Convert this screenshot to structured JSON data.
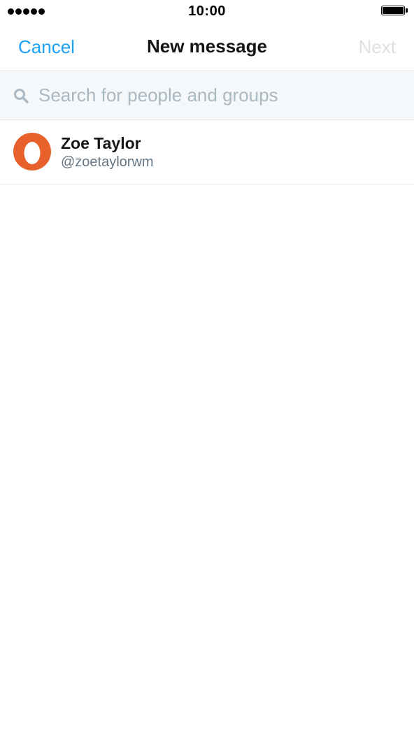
{
  "status_bar": {
    "time": "10:00",
    "signal_icon": "signal-dots-icon",
    "battery_icon": "battery-full-icon",
    "battery_level": 1.0
  },
  "nav": {
    "cancel_label": "Cancel",
    "title": "New message",
    "next_label": "Next"
  },
  "search": {
    "placeholder": "Search for people and groups",
    "value": "",
    "icon": "search-icon"
  },
  "results": [
    {
      "name": "Zoe Taylor",
      "handle": "@zoetaylorwm",
      "avatar_icon": "orange-ring-avatar",
      "avatar_color": "#e8612c"
    }
  ],
  "colors": {
    "accent": "#1da1f2",
    "disabled": "#dde1e4",
    "search_background": "#f5f8fa",
    "placeholder": "#aab8c2",
    "secondary_text": "#657786"
  }
}
